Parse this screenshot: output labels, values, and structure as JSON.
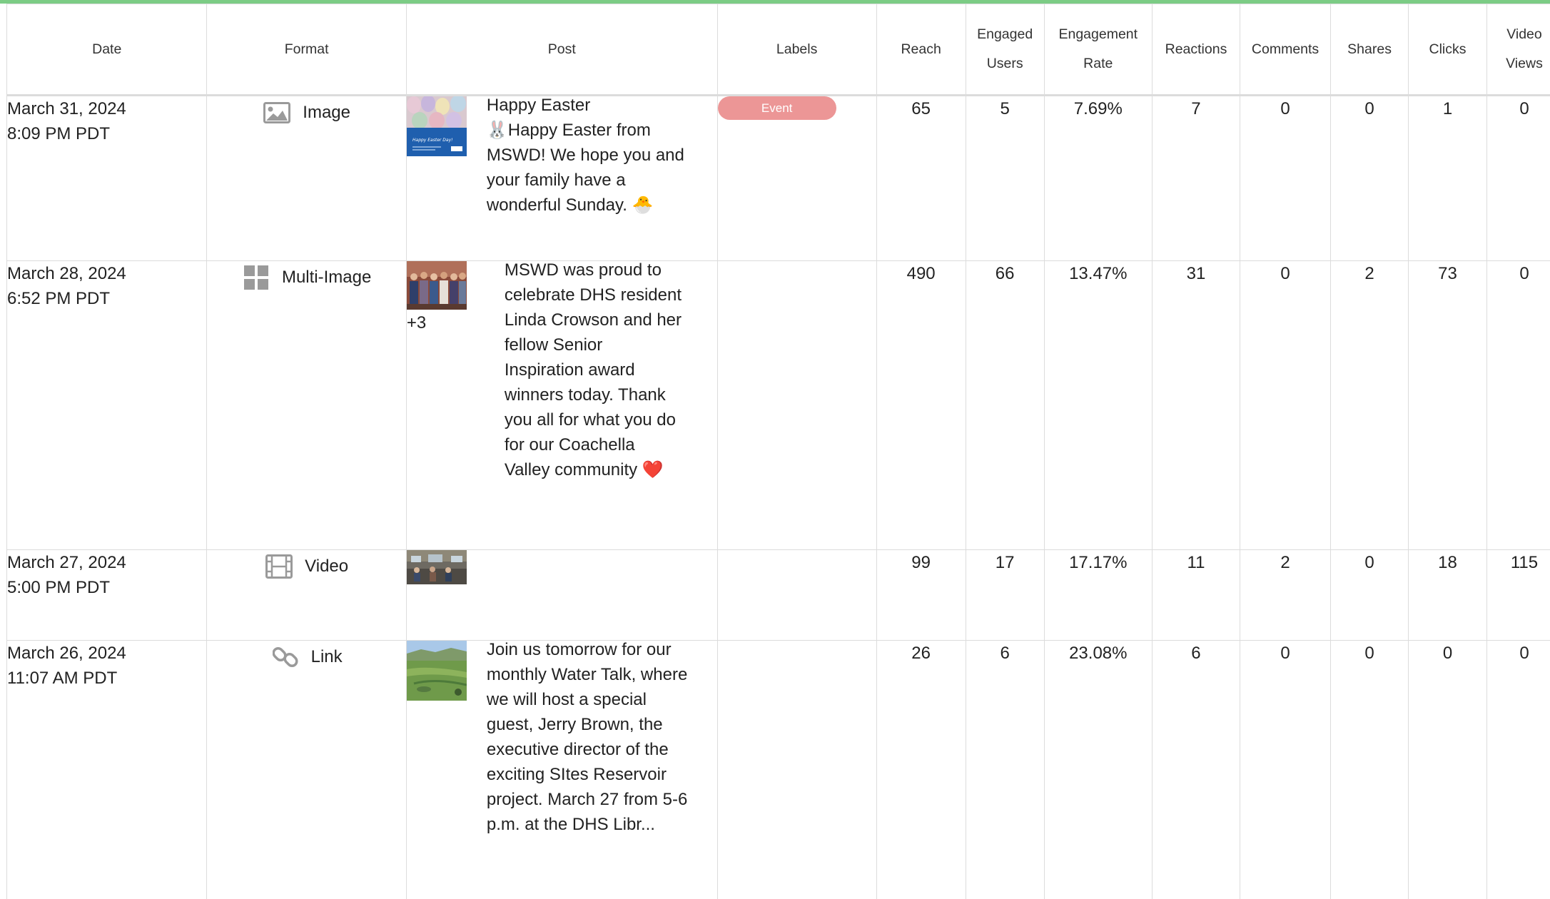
{
  "header": {
    "date": "Date",
    "format": "Format",
    "post": "Post",
    "labels": "Labels",
    "reach": "Reach",
    "engaged_1": "Engaged",
    "engaged_2": "Users",
    "engrate_1": "Engagement",
    "engrate_2": "Rate",
    "reactions": "Reactions",
    "comments": "Comments",
    "shares": "Shares",
    "clicks": "Clicks",
    "video_1": "Video",
    "video_2": "Views"
  },
  "rows": [
    {
      "date": "March 31, 2024",
      "time": "8:09 PM PDT",
      "format": "Image",
      "format_icon": "image-icon",
      "post_text": "Happy Easter\n🐰Happy Easter from MSWD! We hope you and your family have a wonderful Sunday. 🐣",
      "thumb_caption": "Happy Easter Day!",
      "more": "",
      "label": "Event",
      "reach": "65",
      "engaged_users": "5",
      "engagement_rate": "7.69%",
      "reactions": "7",
      "comments": "0",
      "shares": "0",
      "clicks": "1",
      "video_views": "0"
    },
    {
      "date": "March 28, 2024",
      "time": "6:52 PM PDT",
      "format": "Multi-Image",
      "format_icon": "grid-icon",
      "post_text": "MSWD was proud to celebrate DHS resident Linda Crowson and her fellow Senior Inspiration award winners today. Thank you all for what you do for our Coachella Valley community ❤️",
      "more": "+3",
      "label": "",
      "reach": "490",
      "engaged_users": "66",
      "engagement_rate": "13.47%",
      "reactions": "31",
      "comments": "0",
      "shares": "2",
      "clicks": "73",
      "video_views": "0"
    },
    {
      "date": "March 27, 2024",
      "time": "5:00 PM PDT",
      "format": "Video",
      "format_icon": "film-icon",
      "post_text": "",
      "more": "",
      "label": "",
      "reach": "99",
      "engaged_users": "17",
      "engagement_rate": "17.17%",
      "reactions": "11",
      "comments": "2",
      "shares": "0",
      "clicks": "18",
      "video_views": "115"
    },
    {
      "date": "March 26, 2024",
      "time": "11:07 AM PDT",
      "format": "Link",
      "format_icon": "link-icon",
      "post_text": "Join us tomorrow for our monthly Water Talk, where we will host a special guest, Jerry Brown, the executive director of the exciting SItes Reservoir project. March 27 from 5-6 p.m. at the DHS Libr...",
      "more": "",
      "label": "",
      "reach": "26",
      "engaged_users": "6",
      "engagement_rate": "23.08%",
      "reactions": "6",
      "comments": "0",
      "shares": "0",
      "clicks": "0",
      "video_views": "0"
    }
  ],
  "colors": {
    "accent_bar": "#7ccc85",
    "event_badge": "#ec9696",
    "icon_gray": "#9a9a9a",
    "border": "#dcdcdc"
  }
}
